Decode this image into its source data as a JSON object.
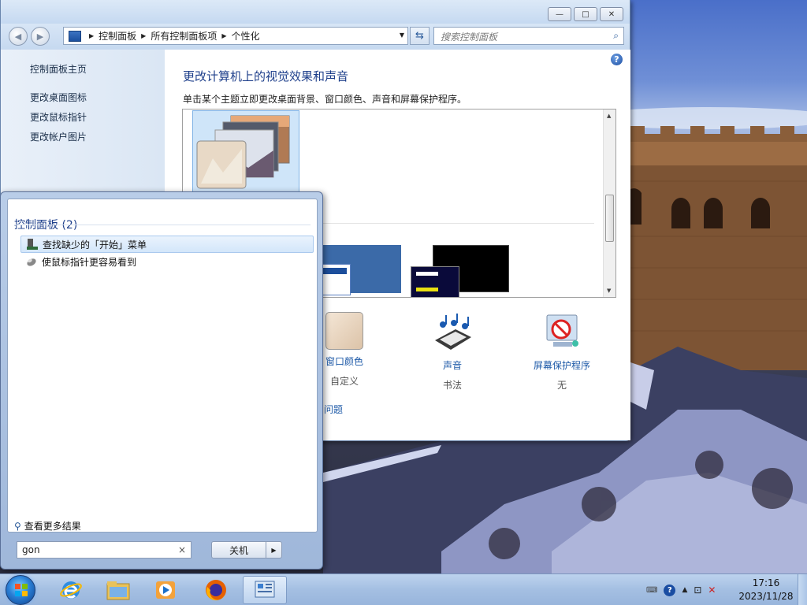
{
  "explorer": {
    "window_buttons": {
      "minimize": "—",
      "maximize": "□",
      "close": "✕"
    },
    "address": {
      "crumbs": [
        "控制面板",
        "所有控制面板项",
        "个性化"
      ]
    },
    "search_placeholder": "搜索控制面板",
    "left_links": [
      "控制面板主页",
      "更改桌面图标",
      "更改鼠标指针",
      "更改帐户图片"
    ],
    "heading": "更改计算机上的视觉效果和声音",
    "subtext": "单击某个主题立即更改桌面背景、窗口颜色、声音和屏幕保护程序。",
    "items": [
      {
        "label": "窗口颜色",
        "sub": "自定义",
        "icon": "window-color-icon"
      },
      {
        "label": "声音",
        "sub": "书法",
        "icon": "sound-icon"
      },
      {
        "label": "屏幕保护程序",
        "sub": "无",
        "icon": "screensaver-icon"
      }
    ],
    "trouble_link": "问题"
  },
  "startmenu": {
    "group": "控制面板 (2)",
    "results": [
      "查找缺少的「开始」菜单",
      "使鼠标指针更容易看到"
    ],
    "more": "查看更多结果",
    "search_value": "gon",
    "clear": "×",
    "shutdown": "关机"
  },
  "taskbar": {
    "apps": [
      "internet-explorer-icon",
      "file-explorer-icon",
      "media-player-icon",
      "firefox-icon",
      "control-panel-icon"
    ],
    "clock": {
      "time": "17:16",
      "date": "2023/11/28"
    }
  },
  "colors": {
    "link": "#1e5aa8",
    "heading": "#1e3f8b",
    "selection": "#cfe5f9"
  }
}
